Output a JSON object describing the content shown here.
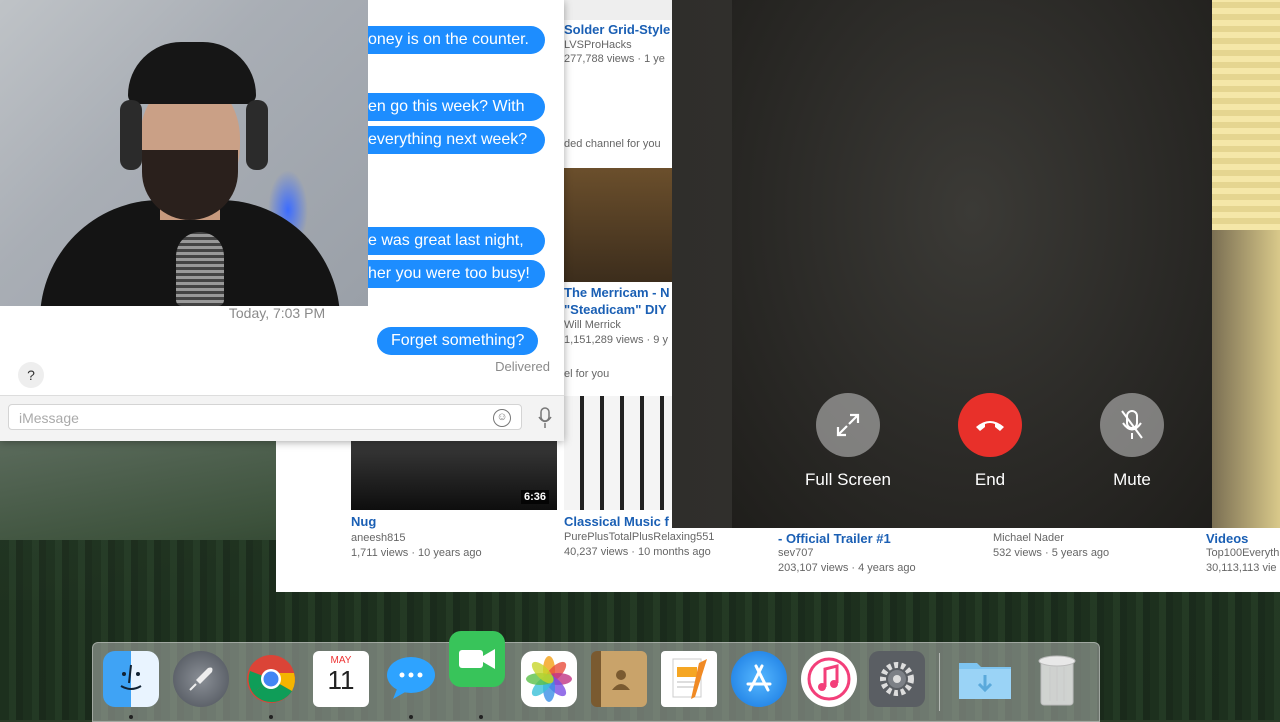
{
  "messages": {
    "bubbles": [
      "oney is on the counter.",
      "en go this week? With",
      "everything next week?",
      "e was great last night,",
      "her you were too busy!"
    ],
    "timestamp": "Today, 7:03 PM",
    "last_message": "Forget something?",
    "status": "Delivered",
    "help": "?",
    "input_placeholder": "iMessage"
  },
  "youtube": {
    "videos": [
      {
        "title": "Solder Grid-Style",
        "channel": "LVSProHacks",
        "meta": "277,788 views · 1 ye"
      },
      {
        "title": "The Merricam - N",
        "title2": "\"Steadicam\" DIY",
        "channel": "Will Merrick",
        "meta": "1,151,289 views · 9 y"
      },
      {
        "title": "Nug",
        "channel": "aneesh815",
        "meta": "1,711 views · 10 years ago",
        "duration": "6:36"
      },
      {
        "title": "Classical Music f",
        "channel": "PurePlusTotalPlusRelaxing551",
        "meta": "40,237 views · 10 months ago"
      },
      {
        "title": "- Official Trailer #1",
        "channel": "sev707",
        "meta": "203,107 views · 4 years ago"
      },
      {
        "title": "",
        "channel": "Michael Nader",
        "meta": "532 views · 5 years ago"
      },
      {
        "title": "Videos",
        "channel": "Top100Everyth",
        "meta": "30,113,113 vie"
      }
    ],
    "rec_text_1": "ded channel for you",
    "rec_text_2": "el for you"
  },
  "facetime": {
    "fullscreen_label": "Full Screen",
    "end_label": "End",
    "mute_label": "Mute",
    "end_color": "#e8302a"
  },
  "dock": {
    "calendar_month": "MAY",
    "calendar_day": "11",
    "items": [
      "finder-icon",
      "launchpad-icon",
      "chrome-icon",
      "calendar-icon",
      "messages-icon",
      "facetime-icon",
      "photos-icon",
      "contacts-icon",
      "pages-icon",
      "app-store-icon",
      "itunes-icon",
      "system-preferences-icon",
      "downloads-folder-icon",
      "trash-icon"
    ]
  }
}
